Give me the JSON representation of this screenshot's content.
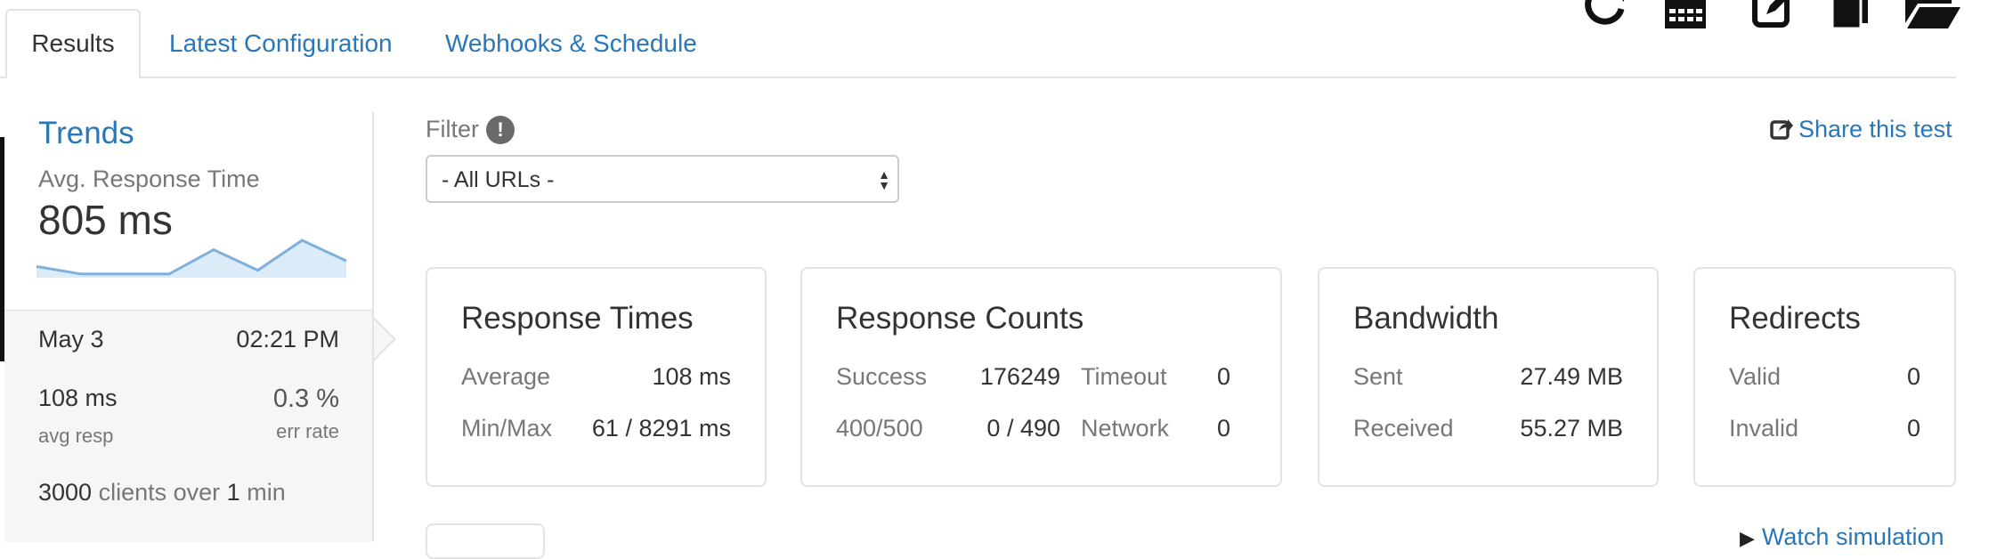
{
  "tabs": {
    "results": "Results",
    "latest_config": "Latest Configuration",
    "webhooks": "Webhooks & Schedule"
  },
  "toolbar_icons": [
    "refresh-icon",
    "grid-icon",
    "edit-icon",
    "copy-icon",
    "folder-open-icon"
  ],
  "trends": {
    "title": "Trends",
    "subtitle": "Avg. Response Time",
    "value": "805 ms",
    "sparkline": [
      0.3,
      0.1,
      0.1,
      0.1,
      0.75,
      0.2,
      1.0,
      0.45
    ]
  },
  "run": {
    "date": "May 3",
    "time": "02:21 PM",
    "avg_value": "108 ms",
    "avg_label": "avg resp",
    "err_value": "0.3 %",
    "err_label": "err rate",
    "clients": "3000",
    "clients_mid": "clients over",
    "duration": "1",
    "duration_unit": "min"
  },
  "filter": {
    "label": "Filter",
    "info": "!",
    "selected": "- All URLs -"
  },
  "share_label": "Share this test",
  "watch_label": "Watch simulation",
  "response_times": {
    "title": "Response Times",
    "average_label": "Average",
    "average_value": "108 ms",
    "minmax_label": "Min/Max",
    "minmax_value": "61 / 8291 ms"
  },
  "response_counts": {
    "title": "Response Counts",
    "success_label": "Success",
    "success_value": "176249",
    "timeout_label": "Timeout",
    "timeout_value": "0",
    "errors_label": "400/500",
    "errors_value": "0 / 490",
    "network_label": "Network",
    "network_value": "0"
  },
  "bandwidth": {
    "title": "Bandwidth",
    "sent_label": "Sent",
    "sent_value": "27.49 MB",
    "received_label": "Received",
    "received_value": "55.27 MB"
  },
  "redirects": {
    "title": "Redirects",
    "valid_label": "Valid",
    "valid_value": "0",
    "invalid_label": "Invalid",
    "invalid_value": "0"
  },
  "colors": {
    "link": "#2a77b8",
    "sparkline_line": "#7fb0dd",
    "sparkline_fill": "#dcebf8"
  }
}
